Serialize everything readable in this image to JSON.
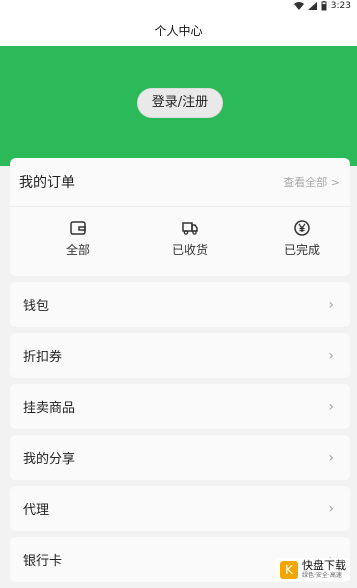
{
  "status": {
    "time": "3:23"
  },
  "header": {
    "title": "个人中心"
  },
  "auth": {
    "button": "登录/注册"
  },
  "orders": {
    "title": "我的订单",
    "view_all": "查看全部 >",
    "items": [
      {
        "label": "全部",
        "icon": "wallet-icon"
      },
      {
        "label": "已收货",
        "icon": "truck-icon"
      },
      {
        "label": "已完成",
        "icon": "yen-circle-icon"
      }
    ]
  },
  "menu": [
    {
      "label": "钱包"
    },
    {
      "label": "折扣券"
    },
    {
      "label": "挂卖商品"
    },
    {
      "label": "我的分享"
    },
    {
      "label": "代理"
    },
    {
      "label": "银行卡"
    }
  ],
  "watermark": {
    "brand": "快盘下载",
    "tagline": "绿色·安全·高速"
  },
  "colors": {
    "hero_green": "#2cb95a",
    "card_bg": "#fafafa",
    "page_bg": "#f2f2f2"
  }
}
